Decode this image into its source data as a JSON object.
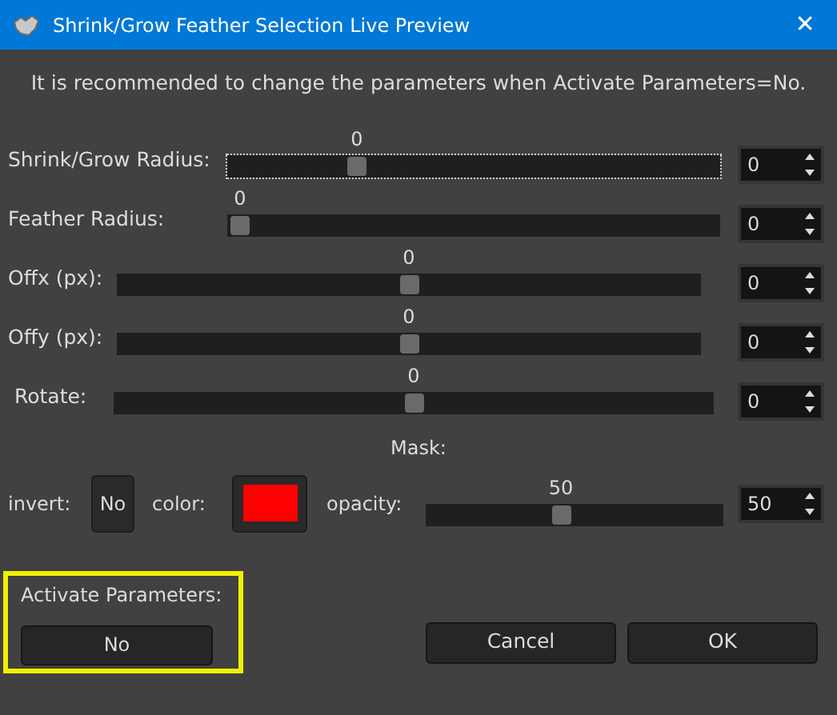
{
  "window": {
    "title": "Shrink/Grow Feather Selection Live Preview",
    "close": "✕"
  },
  "message": "It is recommended to change the parameters when Activate Parameters=No.",
  "sliders": [
    {
      "label": "Shrink/Grow Radius:",
      "value": "0",
      "level": 0.25,
      "spin": "0",
      "focused": true
    },
    {
      "label": "Feather Radius:",
      "value": "0",
      "level": 0,
      "spin": "0",
      "focused": false
    },
    {
      "label": "Offx (px):",
      "value": "0",
      "level": 0.5,
      "spin": "0",
      "focused": false
    },
    {
      "label": "Offy (px):",
      "value": "0",
      "level": 0.5,
      "spin": "0",
      "focused": false
    },
    {
      "label": "Rotate:",
      "value": "0",
      "level": 0.5,
      "spin": "0",
      "focused": false
    }
  ],
  "mask": {
    "title": "Mask:",
    "invert_label": "invert:",
    "invert_button": "No",
    "color_label": "color:",
    "color": "#ff0000",
    "opacity": {
      "label": "opacity:",
      "value": "50",
      "level": 0.45,
      "spin": "50"
    }
  },
  "activate": {
    "label": "Activate Parameters:",
    "button": "No"
  },
  "buttons": [
    "Cancel",
    "OK"
  ]
}
